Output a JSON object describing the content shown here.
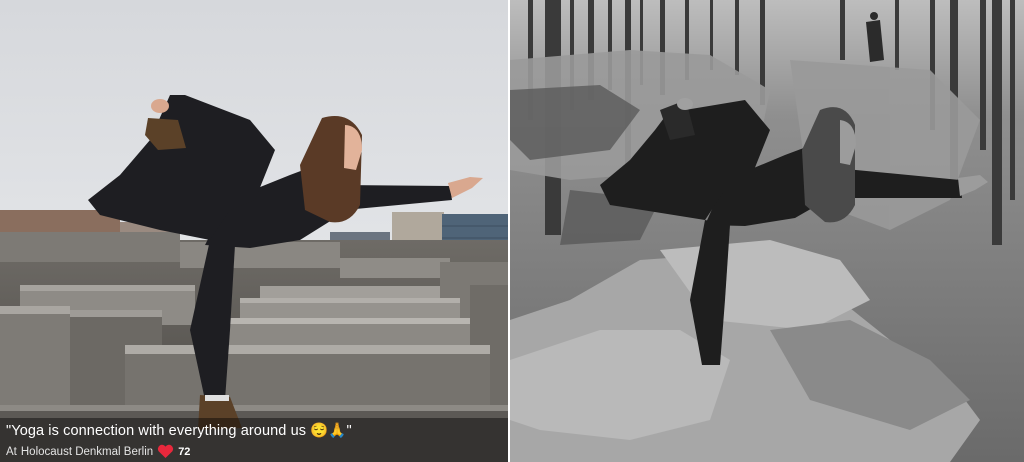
{
  "left_photo": {
    "caption": {
      "quote": "\"Yoga is connection with everything around us 😌🙏\"",
      "location_prefix": "At",
      "location_name": "Holocaust Denkmal Berlin",
      "like_count": "72"
    },
    "heart_color": "#e8283c"
  },
  "right_photo": {}
}
